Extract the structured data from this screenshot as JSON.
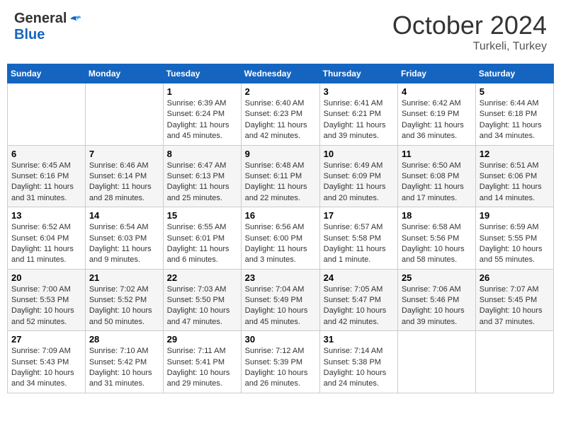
{
  "header": {
    "logo_general": "General",
    "logo_blue": "Blue",
    "month_title": "October 2024",
    "location": "Turkeli, Turkey"
  },
  "weekdays": [
    "Sunday",
    "Monday",
    "Tuesday",
    "Wednesday",
    "Thursday",
    "Friday",
    "Saturday"
  ],
  "weeks": [
    [
      {
        "day": "",
        "info": ""
      },
      {
        "day": "",
        "info": ""
      },
      {
        "day": "1",
        "sunrise": "6:39 AM",
        "sunset": "6:24 PM",
        "daylight": "11 hours and 45 minutes."
      },
      {
        "day": "2",
        "sunrise": "6:40 AM",
        "sunset": "6:23 PM",
        "daylight": "11 hours and 42 minutes."
      },
      {
        "day": "3",
        "sunrise": "6:41 AM",
        "sunset": "6:21 PM",
        "daylight": "11 hours and 39 minutes."
      },
      {
        "day": "4",
        "sunrise": "6:42 AM",
        "sunset": "6:19 PM",
        "daylight": "11 hours and 36 minutes."
      },
      {
        "day": "5",
        "sunrise": "6:44 AM",
        "sunset": "6:18 PM",
        "daylight": "11 hours and 34 minutes."
      }
    ],
    [
      {
        "day": "6",
        "sunrise": "6:45 AM",
        "sunset": "6:16 PM",
        "daylight": "11 hours and 31 minutes."
      },
      {
        "day": "7",
        "sunrise": "6:46 AM",
        "sunset": "6:14 PM",
        "daylight": "11 hours and 28 minutes."
      },
      {
        "day": "8",
        "sunrise": "6:47 AM",
        "sunset": "6:13 PM",
        "daylight": "11 hours and 25 minutes."
      },
      {
        "day": "9",
        "sunrise": "6:48 AM",
        "sunset": "6:11 PM",
        "daylight": "11 hours and 22 minutes."
      },
      {
        "day": "10",
        "sunrise": "6:49 AM",
        "sunset": "6:09 PM",
        "daylight": "11 hours and 20 minutes."
      },
      {
        "day": "11",
        "sunrise": "6:50 AM",
        "sunset": "6:08 PM",
        "daylight": "11 hours and 17 minutes."
      },
      {
        "day": "12",
        "sunrise": "6:51 AM",
        "sunset": "6:06 PM",
        "daylight": "11 hours and 14 minutes."
      }
    ],
    [
      {
        "day": "13",
        "sunrise": "6:52 AM",
        "sunset": "6:04 PM",
        "daylight": "11 hours and 11 minutes."
      },
      {
        "day": "14",
        "sunrise": "6:54 AM",
        "sunset": "6:03 PM",
        "daylight": "11 hours and 9 minutes."
      },
      {
        "day": "15",
        "sunrise": "6:55 AM",
        "sunset": "6:01 PM",
        "daylight": "11 hours and 6 minutes."
      },
      {
        "day": "16",
        "sunrise": "6:56 AM",
        "sunset": "6:00 PM",
        "daylight": "11 hours and 3 minutes."
      },
      {
        "day": "17",
        "sunrise": "6:57 AM",
        "sunset": "5:58 PM",
        "daylight": "11 hours and 1 minute."
      },
      {
        "day": "18",
        "sunrise": "6:58 AM",
        "sunset": "5:56 PM",
        "daylight": "10 hours and 58 minutes."
      },
      {
        "day": "19",
        "sunrise": "6:59 AM",
        "sunset": "5:55 PM",
        "daylight": "10 hours and 55 minutes."
      }
    ],
    [
      {
        "day": "20",
        "sunrise": "7:00 AM",
        "sunset": "5:53 PM",
        "daylight": "10 hours and 52 minutes."
      },
      {
        "day": "21",
        "sunrise": "7:02 AM",
        "sunset": "5:52 PM",
        "daylight": "10 hours and 50 minutes."
      },
      {
        "day": "22",
        "sunrise": "7:03 AM",
        "sunset": "5:50 PM",
        "daylight": "10 hours and 47 minutes."
      },
      {
        "day": "23",
        "sunrise": "7:04 AM",
        "sunset": "5:49 PM",
        "daylight": "10 hours and 45 minutes."
      },
      {
        "day": "24",
        "sunrise": "7:05 AM",
        "sunset": "5:47 PM",
        "daylight": "10 hours and 42 minutes."
      },
      {
        "day": "25",
        "sunrise": "7:06 AM",
        "sunset": "5:46 PM",
        "daylight": "10 hours and 39 minutes."
      },
      {
        "day": "26",
        "sunrise": "7:07 AM",
        "sunset": "5:45 PM",
        "daylight": "10 hours and 37 minutes."
      }
    ],
    [
      {
        "day": "27",
        "sunrise": "7:09 AM",
        "sunset": "5:43 PM",
        "daylight": "10 hours and 34 minutes."
      },
      {
        "day": "28",
        "sunrise": "7:10 AM",
        "sunset": "5:42 PM",
        "daylight": "10 hours and 31 minutes."
      },
      {
        "day": "29",
        "sunrise": "7:11 AM",
        "sunset": "5:41 PM",
        "daylight": "10 hours and 29 minutes."
      },
      {
        "day": "30",
        "sunrise": "7:12 AM",
        "sunset": "5:39 PM",
        "daylight": "10 hours and 26 minutes."
      },
      {
        "day": "31",
        "sunrise": "7:14 AM",
        "sunset": "5:38 PM",
        "daylight": "10 hours and 24 minutes."
      },
      {
        "day": "",
        "info": ""
      },
      {
        "day": "",
        "info": ""
      }
    ]
  ],
  "labels": {
    "sunrise": "Sunrise:",
    "sunset": "Sunset:",
    "daylight": "Daylight:"
  }
}
